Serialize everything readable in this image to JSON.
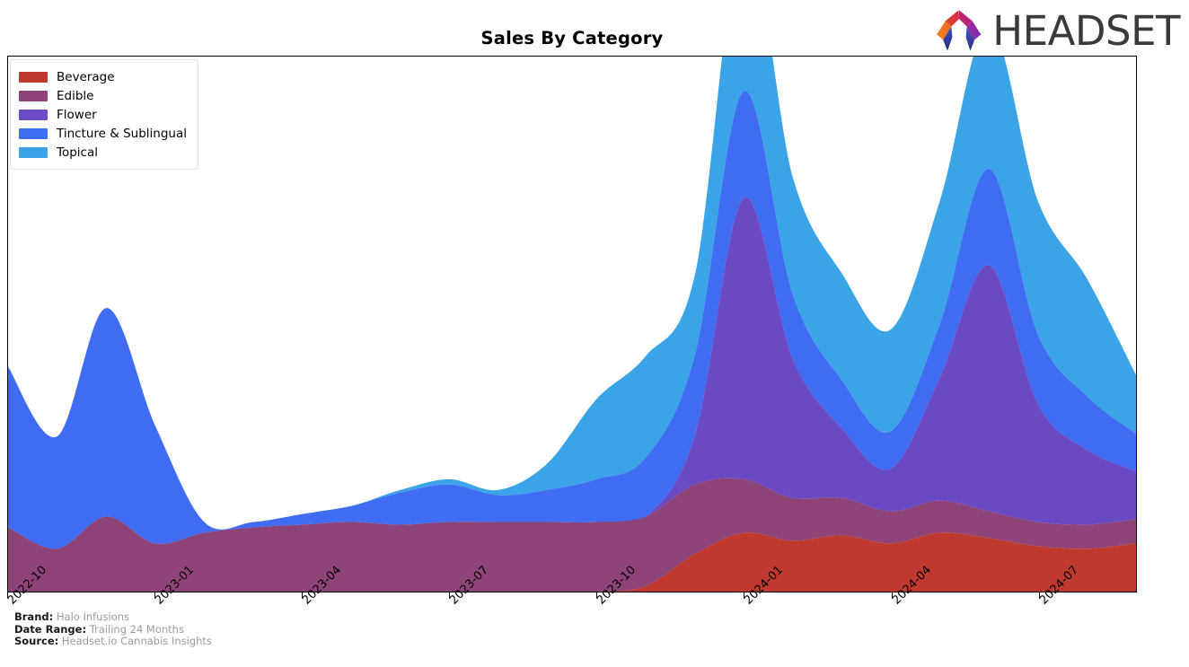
{
  "header": {
    "title": "Sales By Category",
    "logo_text": "HEADSET",
    "logo_icon": "headset-arch-logo"
  },
  "legend": {
    "items": [
      {
        "label": "Beverage",
        "color": "#c0392e"
      },
      {
        "label": "Edible",
        "color": "#8e4478"
      },
      {
        "label": "Flower",
        "color": "#6a4bc4"
      },
      {
        "label": "Tincture & Sublingual",
        "color": "#3f6cf2"
      },
      {
        "label": "Topical",
        "color": "#3ba4e6"
      }
    ]
  },
  "footer": {
    "rows": [
      {
        "key": "Brand:",
        "value": "Halo Infusions"
      },
      {
        "key": "Date Range:",
        "value": "Trailing 24 Months"
      },
      {
        "key": "Source:",
        "value": "Headset.io Cannabis Insights"
      }
    ]
  },
  "chart_data": {
    "type": "area",
    "stacked": true,
    "title": "Sales By Category",
    "xlabel": "",
    "ylabel": "",
    "grid": false,
    "legend_position": "top-left",
    "axis_ticks_x": [
      "2022-10",
      "2023-01",
      "2023-04",
      "2023-07",
      "2023-10",
      "2024-01",
      "2024-04",
      "2024-07"
    ],
    "x": [
      "2022-10",
      "2022-11",
      "2022-12",
      "2023-01",
      "2023-02",
      "2023-03",
      "2023-04",
      "2023-05",
      "2023-06",
      "2023-07",
      "2023-08",
      "2023-09",
      "2023-10",
      "2023-11",
      "2023-12",
      "2024-01",
      "2024-02",
      "2024-03",
      "2024-04",
      "2024-05",
      "2024-06",
      "2024-07",
      "2024-08",
      "2024-09"
    ],
    "series": [
      {
        "name": "Beverage",
        "color": "#c0392e",
        "values": [
          0,
          0,
          0,
          0,
          0,
          0,
          0,
          0,
          0,
          0,
          0,
          0,
          0,
          2,
          14,
          22,
          19,
          21,
          18,
          22,
          20,
          17,
          16,
          18
        ]
      },
      {
        "name": "Edible",
        "color": "#8e4478",
        "values": [
          24,
          16,
          28,
          18,
          22,
          24,
          25,
          26,
          25,
          26,
          26,
          26,
          26,
          26,
          26,
          20,
          16,
          14,
          12,
          12,
          10,
          9,
          9,
          9
        ]
      },
      {
        "name": "Flower",
        "color": "#6a4bc4",
        "values": [
          0,
          0,
          0,
          0,
          0,
          0,
          0,
          0,
          0,
          0,
          0,
          0,
          0,
          0,
          18,
          105,
          52,
          26,
          16,
          46,
          92,
          44,
          28,
          18
        ]
      },
      {
        "name": "Tincture & Sublingual",
        "color": "#3f6cf2",
        "values": [
          60,
          42,
          78,
          44,
          4,
          2,
          4,
          6,
          12,
          14,
          10,
          12,
          16,
          22,
          30,
          40,
          24,
          18,
          14,
          20,
          36,
          26,
          20,
          14
        ]
      },
      {
        "name": "Topical",
        "color": "#3ba4e6",
        "values": [
          0,
          0,
          0,
          0,
          0,
          0,
          0,
          0,
          1,
          2,
          2,
          10,
          30,
          38,
          30,
          60,
          44,
          40,
          38,
          46,
          54,
          50,
          44,
          22
        ]
      }
    ],
    "ylim": [
      0,
      200
    ]
  }
}
